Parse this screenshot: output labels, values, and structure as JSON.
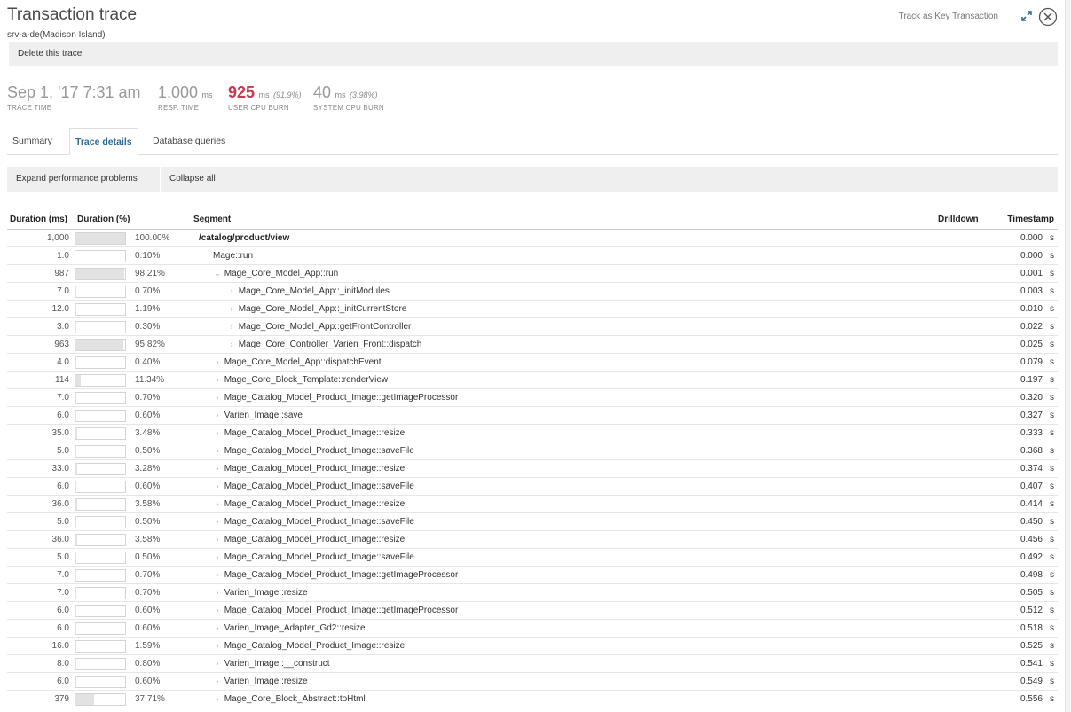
{
  "header": {
    "title": "Transaction trace",
    "subtitle": "srv-a-de(Madison Island)",
    "track_link": "Track as Key Transaction",
    "delete_label": "Delete this trace"
  },
  "stats": {
    "trace_time": {
      "value": "Sep 1, '17 7:31 am",
      "label": "TRACE TIME"
    },
    "resp_time": {
      "value": "1,000",
      "unit": "ms",
      "label": "RESP. TIME"
    },
    "user_cpu": {
      "value": "925",
      "unit": "ms",
      "pct": "(91.9%)",
      "label": "USER CPU BURN"
    },
    "system_cpu": {
      "value": "40",
      "unit": "ms",
      "pct": "(3.98%)",
      "label": "SYSTEM CPU BURN"
    }
  },
  "tabs": [
    {
      "label": "Summary",
      "active": false
    },
    {
      "label": "Trace details",
      "active": true
    },
    {
      "label": "Database queries",
      "active": false
    }
  ],
  "toolbar": {
    "expand_label": "Expand performance problems",
    "collapse_label": "Collapse all"
  },
  "table": {
    "columns": {
      "duration_ms": "Duration (ms)",
      "duration_pct": "Duration (%)",
      "segment": "Segment",
      "drilldown": "Drilldown",
      "timestamp": "Timestamp"
    },
    "unit": "s",
    "rows": [
      {
        "dur": "1,000",
        "pct": "100.00%",
        "frac": 1.0,
        "indent": 0,
        "arrow": "",
        "seg": "/catalog/product/view",
        "ts": "0.000"
      },
      {
        "dur": "1.0",
        "pct": "0.10%",
        "frac": 0.001,
        "indent": 1,
        "arrow": "",
        "seg": "Mage::run",
        "ts": "0.000"
      },
      {
        "dur": "987",
        "pct": "98.21%",
        "frac": 0.9821,
        "indent": 1,
        "arrow": "down",
        "seg": "Mage_Core_Model_App::run",
        "ts": "0.001"
      },
      {
        "dur": "7.0",
        "pct": "0.70%",
        "frac": 0.007,
        "indent": 2,
        "arrow": "right",
        "seg": "Mage_Core_Model_App::_initModules",
        "ts": "0.003"
      },
      {
        "dur": "12.0",
        "pct": "1.19%",
        "frac": 0.0119,
        "indent": 2,
        "arrow": "right",
        "seg": "Mage_Core_Model_App::_initCurrentStore",
        "ts": "0.010"
      },
      {
        "dur": "3.0",
        "pct": "0.30%",
        "frac": 0.003,
        "indent": 2,
        "arrow": "right",
        "seg": "Mage_Core_Model_App::getFrontController",
        "ts": "0.022"
      },
      {
        "dur": "963",
        "pct": "95.82%",
        "frac": 0.9582,
        "indent": 2,
        "arrow": "right",
        "seg": "Mage_Core_Controller_Varien_Front::dispatch",
        "ts": "0.025"
      },
      {
        "dur": "4.0",
        "pct": "0.40%",
        "frac": 0.004,
        "indent": 1,
        "arrow": "right",
        "seg": "Mage_Core_Model_App::dispatchEvent",
        "ts": "0.079"
      },
      {
        "dur": "114",
        "pct": "11.34%",
        "frac": 0.1134,
        "indent": 1,
        "arrow": "right",
        "seg": "Mage_Core_Block_Template::renderView",
        "ts": "0.197"
      },
      {
        "dur": "7.0",
        "pct": "0.70%",
        "frac": 0.007,
        "indent": 1,
        "arrow": "right",
        "seg": "Mage_Catalog_Model_Product_Image::getImageProcessor",
        "ts": "0.320"
      },
      {
        "dur": "6.0",
        "pct": "0.60%",
        "frac": 0.006,
        "indent": 1,
        "arrow": "right",
        "seg": "Varien_Image::save",
        "ts": "0.327"
      },
      {
        "dur": "35.0",
        "pct": "3.48%",
        "frac": 0.0348,
        "indent": 1,
        "arrow": "right",
        "seg": "Mage_Catalog_Model_Product_Image::resize",
        "ts": "0.333"
      },
      {
        "dur": "5.0",
        "pct": "0.50%",
        "frac": 0.005,
        "indent": 1,
        "arrow": "right",
        "seg": "Mage_Catalog_Model_Product_Image::saveFile",
        "ts": "0.368"
      },
      {
        "dur": "33.0",
        "pct": "3.28%",
        "frac": 0.0328,
        "indent": 1,
        "arrow": "right",
        "seg": "Mage_Catalog_Model_Product_Image::resize",
        "ts": "0.374"
      },
      {
        "dur": "6.0",
        "pct": "0.60%",
        "frac": 0.006,
        "indent": 1,
        "arrow": "right",
        "seg": "Mage_Catalog_Model_Product_Image::saveFile",
        "ts": "0.407"
      },
      {
        "dur": "36.0",
        "pct": "3.58%",
        "frac": 0.0358,
        "indent": 1,
        "arrow": "right",
        "seg": "Mage_Catalog_Model_Product_Image::resize",
        "ts": "0.414"
      },
      {
        "dur": "5.0",
        "pct": "0.50%",
        "frac": 0.005,
        "indent": 1,
        "arrow": "right",
        "seg": "Mage_Catalog_Model_Product_Image::saveFile",
        "ts": "0.450"
      },
      {
        "dur": "36.0",
        "pct": "3.58%",
        "frac": 0.0358,
        "indent": 1,
        "arrow": "right",
        "seg": "Mage_Catalog_Model_Product_Image::resize",
        "ts": "0.456"
      },
      {
        "dur": "5.0",
        "pct": "0.50%",
        "frac": 0.005,
        "indent": 1,
        "arrow": "right",
        "seg": "Mage_Catalog_Model_Product_Image::saveFile",
        "ts": "0.492"
      },
      {
        "dur": "7.0",
        "pct": "0.70%",
        "frac": 0.007,
        "indent": 1,
        "arrow": "right",
        "seg": "Mage_Catalog_Model_Product_Image::getImageProcessor",
        "ts": "0.498"
      },
      {
        "dur": "7.0",
        "pct": "0.70%",
        "frac": 0.007,
        "indent": 1,
        "arrow": "right",
        "seg": "Varien_Image::resize",
        "ts": "0.505"
      },
      {
        "dur": "6.0",
        "pct": "0.60%",
        "frac": 0.006,
        "indent": 1,
        "arrow": "right",
        "seg": "Mage_Catalog_Model_Product_Image::getImageProcessor",
        "ts": "0.512"
      },
      {
        "dur": "6.0",
        "pct": "0.60%",
        "frac": 0.006,
        "indent": 1,
        "arrow": "right",
        "seg": "Varien_Image_Adapter_Gd2::resize",
        "ts": "0.518"
      },
      {
        "dur": "16.0",
        "pct": "1.59%",
        "frac": 0.0159,
        "indent": 1,
        "arrow": "right",
        "seg": "Mage_Catalog_Model_Product_Image::resize",
        "ts": "0.525"
      },
      {
        "dur": "8.0",
        "pct": "0.80%",
        "frac": 0.008,
        "indent": 1,
        "arrow": "right",
        "seg": "Varien_Image::__construct",
        "ts": "0.541"
      },
      {
        "dur": "6.0",
        "pct": "0.60%",
        "frac": 0.006,
        "indent": 1,
        "arrow": "right",
        "seg": "Varien_Image::resize",
        "ts": "0.549"
      },
      {
        "dur": "379",
        "pct": "37.71%",
        "frac": 0.3771,
        "indent": 1,
        "arrow": "right",
        "seg": "Mage_Core_Block_Abstract::toHtml",
        "ts": "0.556"
      }
    ]
  }
}
